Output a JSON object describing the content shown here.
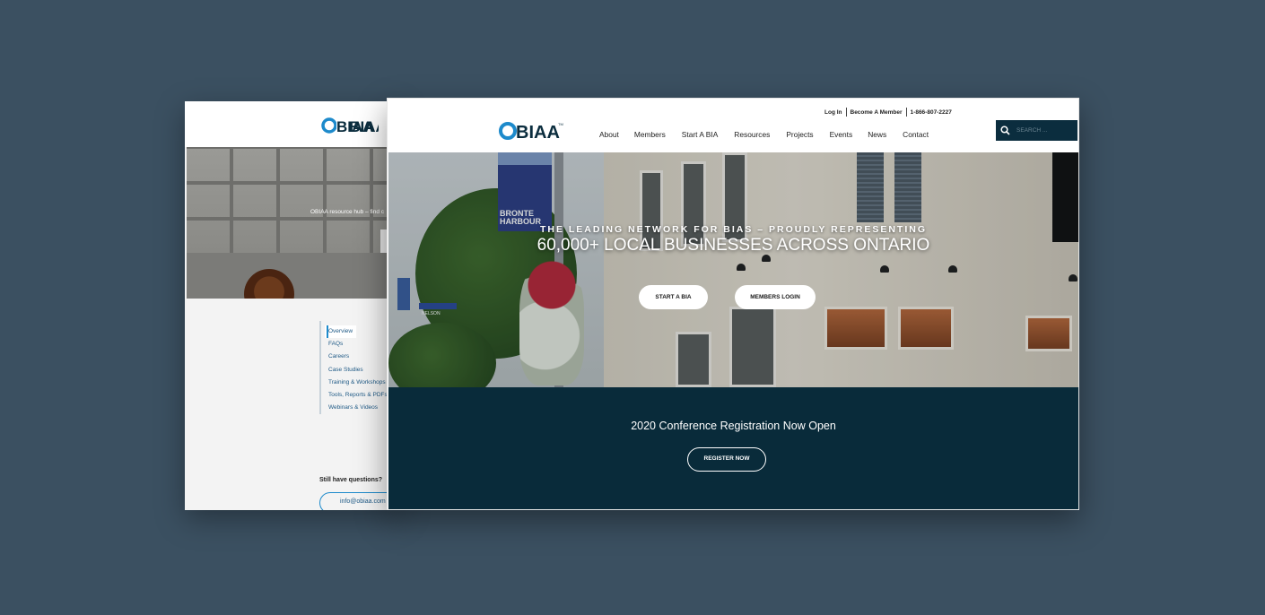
{
  "colors": {
    "background": "#3b5061",
    "brand_dark": "#092b3a",
    "brand_blue": "#1d8acb"
  },
  "back_page": {
    "logo_text": "OBIAA",
    "hero_text": "OBIAA resource hub – find c",
    "nav_items": [
      "Overview",
      "FAQs",
      "Careers",
      "Case Studies",
      "Training & Workshops",
      "Tools, Reports & PDFs",
      "Webinars & Videos"
    ],
    "question": "Still have questions?",
    "email_button": "info@obiaa.com"
  },
  "front_page": {
    "utility_links": {
      "login": "Log In",
      "become_member": "Become A Member",
      "phone": "1-866-807-2227"
    },
    "logo_text": "OBIAA",
    "nav": [
      "About",
      "Members",
      "Start A BIA",
      "Resources",
      "Projects",
      "Events",
      "News",
      "Contact"
    ],
    "search": {
      "placeholder": "SEARCH ...",
      "icon": "search-icon"
    },
    "hero": {
      "banner_text": "BRONTE HARBOUR",
      "street_sign": "NELSON",
      "subtitle": "THE LEADING NETWORK FOR BIAS – PROUDLY REPRESENTING",
      "title": "60,000+ LOCAL BUSINESSES ACROSS ONTARIO",
      "start_button": "START A BIA",
      "login_button": "MEMBERS LOGIN"
    },
    "cta": {
      "title": "2020 Conference Registration Now Open",
      "button": "REGISTER NOW"
    }
  }
}
